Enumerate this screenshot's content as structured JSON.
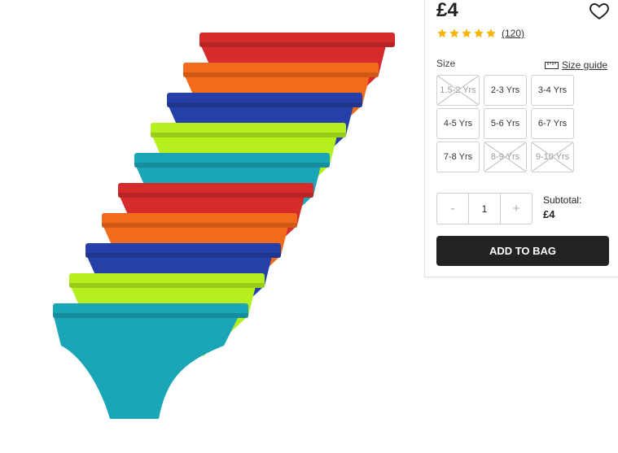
{
  "product": {
    "price": "£4",
    "rating_stars": 5,
    "review_count": "(120)",
    "colors": {
      "star": "#f5b400",
      "button_bg": "#222222",
      "brief_colors": [
        "#d62b2b",
        "#f26a1b",
        "#2540a8",
        "#b6ef1e",
        "#1ba6b8"
      ]
    }
  },
  "size": {
    "label": "Size",
    "guide_label": "Size guide",
    "options": [
      {
        "label": "1.5-2 Yrs",
        "available": false
      },
      {
        "label": "2-3 Yrs",
        "available": true
      },
      {
        "label": "3-4 Yrs",
        "available": true
      },
      {
        "label": "4-5 Yrs",
        "available": true
      },
      {
        "label": "5-6 Yrs",
        "available": true
      },
      {
        "label": "6-7 Yrs",
        "available": true
      },
      {
        "label": "7-8 Yrs",
        "available": true
      },
      {
        "label": "8-9 Yrs",
        "available": false
      },
      {
        "label": "9-10 Yrs",
        "available": false
      }
    ]
  },
  "quantity": {
    "minus": "-",
    "value": "1",
    "plus": "+"
  },
  "subtotal": {
    "label": "Subtotal:",
    "value": "£4"
  },
  "cta": {
    "add_to_bag": "ADD TO BAG"
  },
  "icons": {
    "wishlist": "heart-icon",
    "size_guide": "ruler-icon",
    "rating": "star-icon"
  }
}
